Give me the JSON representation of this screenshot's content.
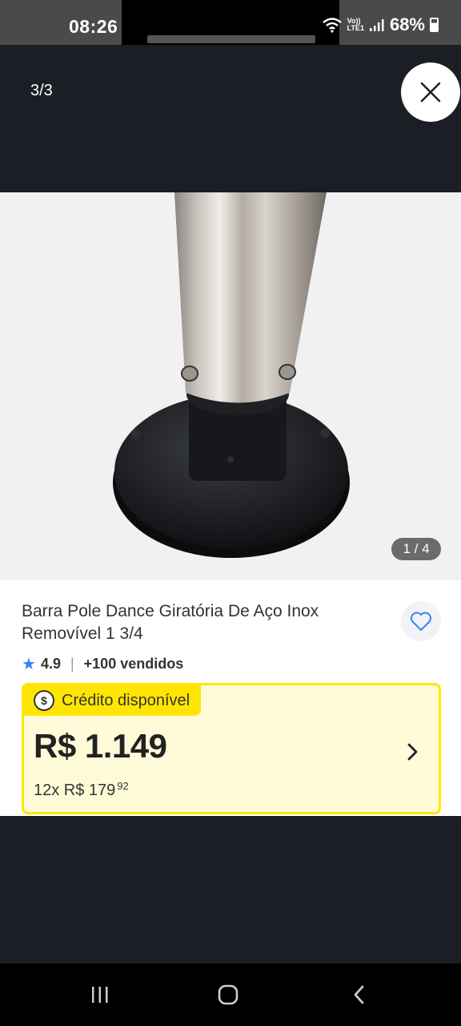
{
  "status_bar": {
    "time": "08:26",
    "network": "LTE1",
    "battery": "68%"
  },
  "viewer": {
    "counter": "3/3",
    "close_icon": "close-icon"
  },
  "image": {
    "counter": "1 / 4"
  },
  "product": {
    "title": "Barra Pole Dance Giratória De Aço Inox Removível 1 3/4",
    "rating": "4.9",
    "sold": "+100 vendidos",
    "favorite_icon": "heart-outline-icon"
  },
  "credit": {
    "label": "Crédito disponível",
    "price": "R$ 1.149",
    "installments": "12x R$ 179",
    "installments_cents": "92"
  },
  "colors": {
    "accent_blue": "#3483fa",
    "credit_yellow": "#ffe600",
    "credit_bg": "#fffbd9",
    "dark_bg": "#1b1e24"
  }
}
